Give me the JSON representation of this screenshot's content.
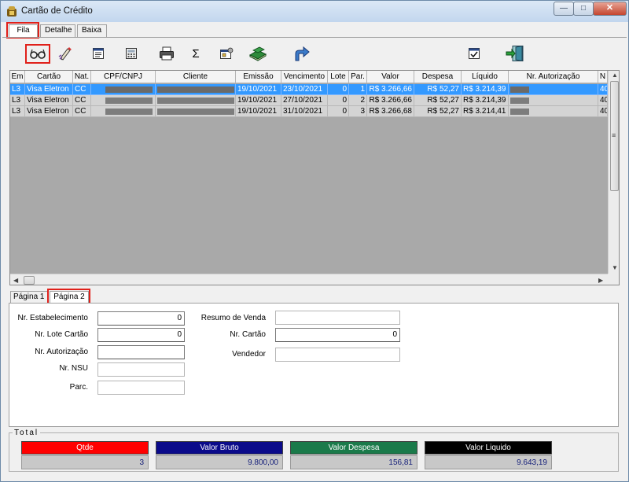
{
  "window": {
    "title": "Cartão de Crédito"
  },
  "tabs": [
    "Fila",
    "Detalhe",
    "Baixa"
  ],
  "toolbar": {
    "icons": [
      "view-glasses-icon",
      "edit-pen-icon",
      "form-icon",
      "calculator-icon",
      "print-icon",
      "sum-icon",
      "properties-icon",
      "book-icon",
      "forward-arrow-icon",
      "check-icon",
      "exit-door-icon"
    ],
    "sum_symbol": "Σ"
  },
  "grid": {
    "headers": [
      "Em",
      "Cartão",
      "Nat.",
      "CPF/CNPJ",
      "Cliente",
      "Emissão",
      "Vencimento",
      "Lote",
      "Par.",
      "Valor",
      "Despesa",
      "Líquido",
      "Nr. Autorização",
      "N"
    ],
    "rows": [
      {
        "em": "L3",
        "cartao": "Visa Eletron",
        "nat": "CC",
        "emissao": "19/10/2021",
        "vencimento": "23/10/2021",
        "lote": "0",
        "par": "1",
        "valor": "R$ 3.266,66",
        "despesa": "R$ 52,27",
        "liquido": "R$ 3.214,39",
        "n": "40"
      },
      {
        "em": "L3",
        "cartao": "Visa Eletron",
        "nat": "CC",
        "emissao": "19/10/2021",
        "vencimento": "27/10/2021",
        "lote": "0",
        "par": "2",
        "valor": "R$ 3.266,66",
        "despesa": "R$ 52,27",
        "liquido": "R$ 3.214,39",
        "n": "40"
      },
      {
        "em": "L3",
        "cartao": "Visa Eletron",
        "nat": "CC",
        "emissao": "19/10/2021",
        "vencimento": "31/10/2021",
        "lote": "0",
        "par": "3",
        "valor": "R$ 3.266,68",
        "despesa": "R$ 52,27",
        "liquido": "R$ 3.214,41",
        "n": "40"
      }
    ]
  },
  "subtabs": [
    "Página 1",
    "Página 2"
  ],
  "form": {
    "nr_estabelecimento": {
      "label": "Nr. Estabelecimento",
      "value": "0"
    },
    "nr_lote_cartao": {
      "label": "Nr. Lote Cartão",
      "value": "0"
    },
    "nr_autorizacao": {
      "label": "Nr. Autorização",
      "value": ""
    },
    "nr_nsu": {
      "label": "Nr. NSU",
      "value": ""
    },
    "parc": {
      "label": "Parc.",
      "value": ""
    },
    "resumo_venda": {
      "label": "Resumo de Venda",
      "value": ""
    },
    "nr_cartao": {
      "label": "Nr. Cartão",
      "value": "0"
    },
    "vendedor": {
      "label": "Vendedor",
      "value": ""
    }
  },
  "totals": {
    "label": "Total",
    "qtde": {
      "label": "Qtde",
      "value": "3",
      "color": "#ff0000"
    },
    "valor_bruto": {
      "label": "Valor Bruto",
      "value": "9.800,00",
      "color": "#0a0a8a"
    },
    "valor_despesa": {
      "label": "Valor Despesa",
      "value": "156,81",
      "color": "#1a7a4a"
    },
    "valor_liquido": {
      "label": "Valor Liquido",
      "value": "9.643,19",
      "color": "#000000"
    }
  }
}
